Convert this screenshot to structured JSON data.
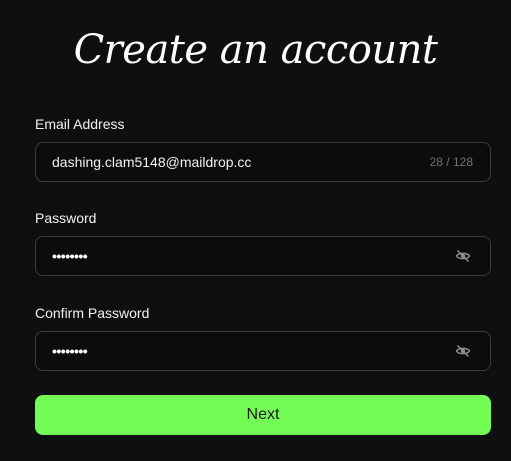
{
  "title": "Create an account",
  "email": {
    "label": "Email Address",
    "value": "dashing.clam5148@maildrop.cc",
    "counter": "28 / 128"
  },
  "password": {
    "label": "Password",
    "masked_value": "••••••••",
    "toggle_icon": "eye-slash-icon"
  },
  "confirm_password": {
    "label": "Confirm Password",
    "masked_value": "••••••••",
    "toggle_icon": "eye-slash-icon"
  },
  "next_button": {
    "label": "Next",
    "color": "#74fc56"
  },
  "colors": {
    "background": "#0e1010",
    "field_border": "#3a3d3d"
  }
}
